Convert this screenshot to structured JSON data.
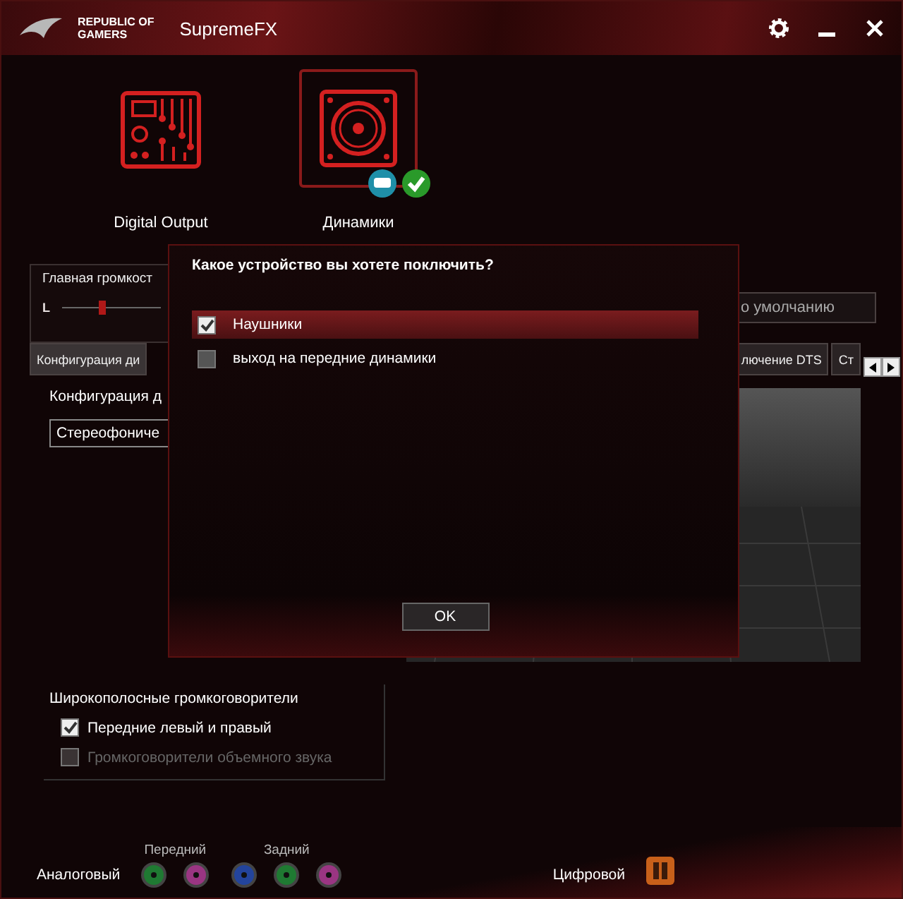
{
  "window": {
    "logo_lines": [
      "REPUBLIC OF",
      "GAMERS"
    ],
    "title": "SupremeFX"
  },
  "devices": [
    {
      "label": "Digital Output",
      "kind": "board",
      "selected": false
    },
    {
      "label": "Динамики",
      "kind": "speaker",
      "selected": true
    }
  ],
  "volume": {
    "title": "Главная громкост",
    "channel": "L",
    "level": 0.4
  },
  "default_button": "о умолчанию",
  "tabs_left": [
    {
      "label": "Конфигурация ди",
      "selected": true
    }
  ],
  "tabs_right": [
    {
      "label": "лючение DTS",
      "selected": false
    },
    {
      "label": "Ст",
      "selected": false
    }
  ],
  "config": {
    "label": "Конфигурация д",
    "dropdown": "Стереофониче"
  },
  "wideband": {
    "title": "Широкополосные громкоговорители",
    "options": [
      {
        "label": "Передние левый и правый",
        "checked": true,
        "disabled": false
      },
      {
        "label": "Громкоговорители объемного звука",
        "checked": false,
        "disabled": true
      }
    ]
  },
  "jacks": {
    "analog_label": "Аналоговый",
    "groups": [
      {
        "label": "Передний",
        "jacks": [
          {
            "color": "#1f7a32"
          },
          {
            "color": "#9a3582"
          }
        ]
      },
      {
        "label": "Задний",
        "jacks": [
          {
            "color": "#23449c"
          },
          {
            "color": "#1f7a32"
          },
          {
            "color": "#9a3582"
          }
        ]
      }
    ],
    "digital_label": "Цифровой"
  },
  "dialog": {
    "title": "Какое устройство вы хотете поключить?",
    "options": [
      {
        "label": "Наушники",
        "checked": true,
        "selected": true
      },
      {
        "label": "выход на передние динамики",
        "checked": false,
        "selected": false
      }
    ],
    "ok": "OK"
  }
}
